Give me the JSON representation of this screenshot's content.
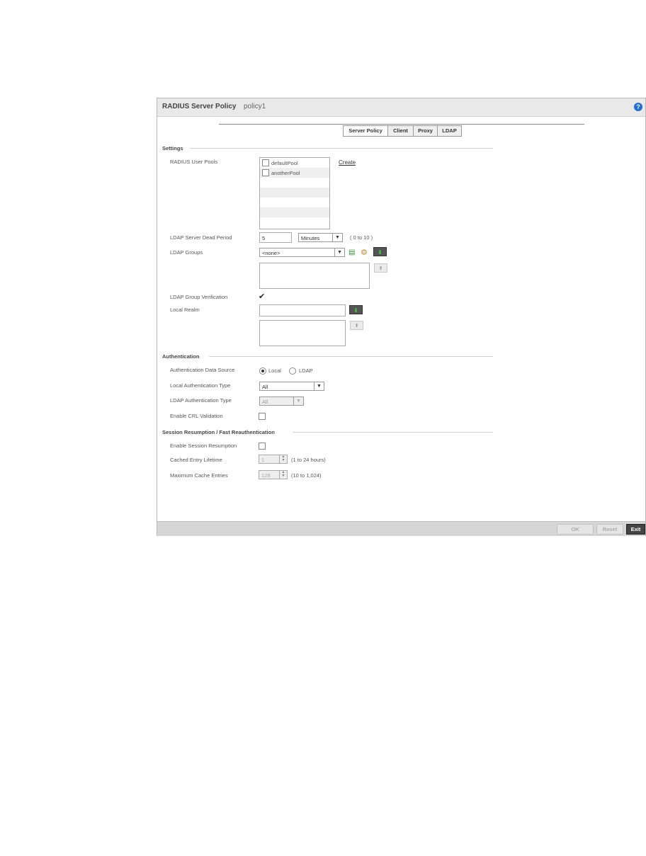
{
  "header": {
    "title": "RADIUS Server Policy",
    "policy_name": "policy1",
    "help_icon": "?"
  },
  "tabs": [
    {
      "label": "Server Policy",
      "active": true
    },
    {
      "label": "Client",
      "active": false
    },
    {
      "label": "Proxy",
      "active": false
    },
    {
      "label": "LDAP",
      "active": false
    }
  ],
  "settings": {
    "section_title": "Settings",
    "user_pools": {
      "label": "RADIUS User Pools",
      "items": [
        {
          "name": "defaultPool",
          "checked": false
        },
        {
          "name": "anotherPool",
          "checked": false
        }
      ],
      "create_link": "Create"
    },
    "dead_period": {
      "label": "LDAP Server Dead Period",
      "value": "5",
      "unit": "Minutes",
      "range": "( 0 to 10 )"
    },
    "ldap_groups": {
      "label": "LDAP Groups",
      "selected": "<none>"
    },
    "group_verification": {
      "label": "LDAP Group Verification",
      "checked": true,
      "check_glyph": "✔"
    },
    "local_realm": {
      "label": "Local Realm",
      "value": ""
    }
  },
  "authentication": {
    "section_title": "Authentication",
    "data_source": {
      "label": "Authentication Data Source",
      "options": [
        "Local",
        "LDAP"
      ],
      "selected": "Local"
    },
    "local_type": {
      "label": "Local Authentication Type",
      "selected": "All"
    },
    "ldap_type": {
      "label": "LDAP Authentication Type",
      "selected": "All"
    },
    "crl": {
      "label": "Enable CRL Validation",
      "checked": false
    }
  },
  "session": {
    "section_title": "Session Resumption / Fast Reauthentication",
    "enable": {
      "label": "Enable Session Resumption",
      "checked": false
    },
    "lifetime": {
      "label": "Cached Entry Lifetime",
      "value": "1",
      "range": "(1 to 24 hours)"
    },
    "max_entries": {
      "label": "Maximum Cache Entries",
      "value": "128",
      "range": "(10 to 1,024)"
    }
  },
  "footer": {
    "ok": "OK",
    "reset": "Reset",
    "exit": "Exit"
  },
  "colors": {
    "help": "#1f6fd6",
    "green_arrow": "#43d043",
    "exit_bg": "#444444"
  }
}
